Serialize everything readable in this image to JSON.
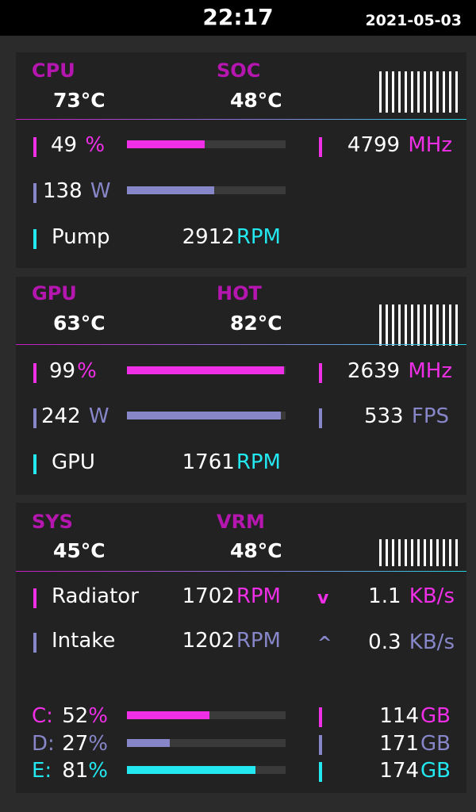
{
  "header": {
    "time": "22:17",
    "date": "2021-05-03"
  },
  "cpu": {
    "label_a": "CPU",
    "temp_a": "73°C",
    "label_b": "SOC",
    "temp_b": "48°C",
    "load_value": "49",
    "load_unit": "%",
    "load_level": 0.49,
    "power_value": "138",
    "power_unit": "W",
    "power_level": 0.55,
    "clock_value": "4799",
    "clock_unit": "MHz",
    "fan_name": "Pump",
    "fan_value": "2912",
    "fan_unit": "RPM"
  },
  "gpu": {
    "label_a": "GPU",
    "temp_a": "63°C",
    "label_b": "HOT",
    "temp_b": "82°C",
    "load_value": "99",
    "load_unit": "%",
    "load_level": 0.99,
    "power_value": "242",
    "power_unit": "W",
    "power_level": 0.97,
    "clock_value": "2639",
    "clock_unit": "MHz",
    "fps_value": "533",
    "fps_unit": "FPS",
    "fan_name": "GPU",
    "fan_value": "1761",
    "fan_unit": "RPM"
  },
  "sys": {
    "label_a": "SYS",
    "temp_a": "45°C",
    "label_b": "VRM",
    "temp_b": "48°C",
    "fan1_name": "Radiator",
    "fan1_value": "1702",
    "fan1_unit": "RPM",
    "fan2_name": "Intake",
    "fan2_value": "1202",
    "fan2_unit": "RPM",
    "down_icon": "v",
    "down_value": "1.1",
    "down_unit": "KB/s",
    "up_icon": "^",
    "up_value": "0.3",
    "up_unit": "KB/s",
    "drives": [
      {
        "letter": "C:",
        "percent": "52",
        "unit": "%",
        "level": 0.52,
        "free": "114",
        "free_unit": "GB"
      },
      {
        "letter": "D:",
        "percent": "27",
        "unit": "%",
        "level": 0.27,
        "free": "171",
        "free_unit": "GB"
      },
      {
        "letter": "E:",
        "percent": "81",
        "unit": "%",
        "level": 0.81,
        "free": "174",
        "free_unit": "GB"
      }
    ]
  },
  "colors": {
    "accent_magenta": "#ee2fe6",
    "accent_lavender": "#8686c8",
    "accent_cyan": "#23e8f0",
    "label_purple": "#b516b0"
  }
}
